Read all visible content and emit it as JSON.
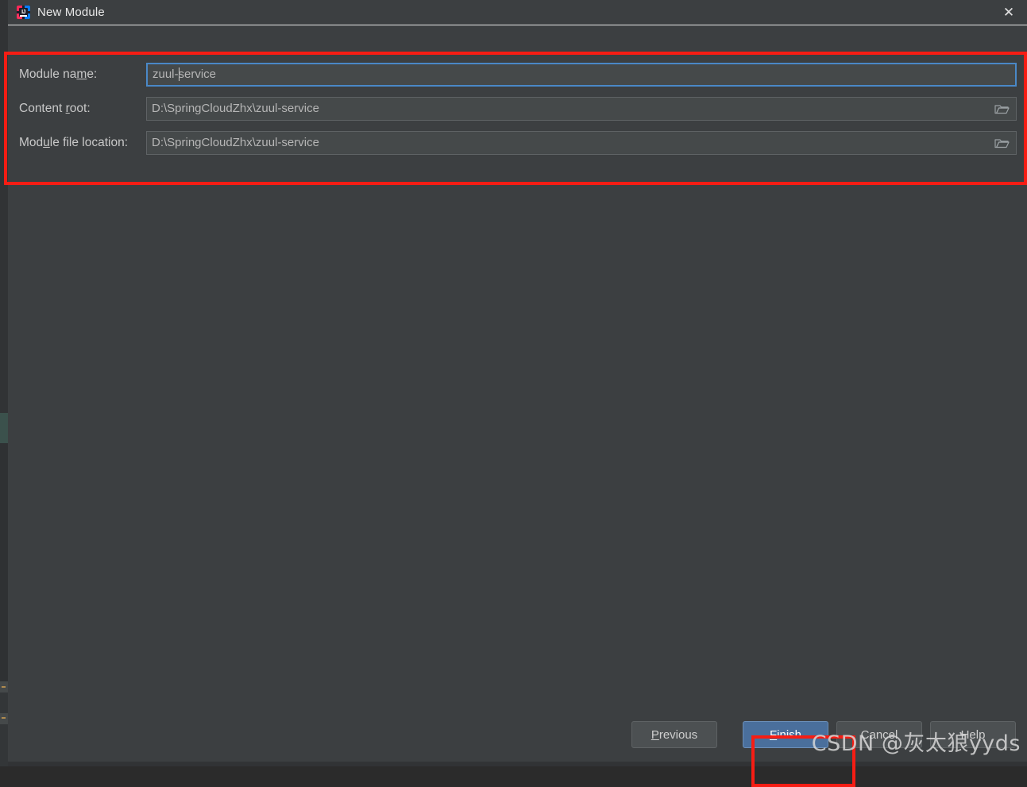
{
  "window": {
    "title": "New Module",
    "app_icon": "intellij-idea-icon",
    "close_icon": "close-icon"
  },
  "form": {
    "rows": [
      {
        "label_before": "Module na",
        "label_mnemonic": "m",
        "label_after": "e:",
        "value": "zuul-service",
        "value_before_caret": "zuul-",
        "value_after_caret": "service",
        "focused": true,
        "has_browse": false,
        "browse_icon": "folder-icon"
      },
      {
        "label_before": "Content ",
        "label_mnemonic": "r",
        "label_after": "oot:",
        "value": "D:\\SpringCloudZhx\\zuul-service",
        "focused": false,
        "has_browse": true,
        "browse_icon": "folder-icon"
      },
      {
        "label_before": "Mod",
        "label_mnemonic": "u",
        "label_after": "le file location:",
        "value": "D:\\SpringCloudZhx\\zuul-service",
        "focused": false,
        "has_browse": true,
        "browse_icon": "folder-icon"
      }
    ]
  },
  "buttons": {
    "previous": {
      "before": "",
      "mnemonic": "P",
      "after": "revious"
    },
    "finish": {
      "before": "",
      "mnemonic": "F",
      "after": "inish"
    },
    "cancel": {
      "before": "C",
      "mnemonic": "",
      "after": "ancel"
    },
    "help": {
      "before": "H",
      "mnemonic": "",
      "after": "elp"
    }
  },
  "watermark": {
    "text": "CSDN @灰太狼yyds"
  },
  "colors": {
    "background": "#3c3f41",
    "field_background": "#45494a",
    "focus_border": "#4a88c7",
    "primary_button": "#4a6f9c",
    "annotation_red": "#f61d14",
    "text": "#c8c8c8"
  }
}
